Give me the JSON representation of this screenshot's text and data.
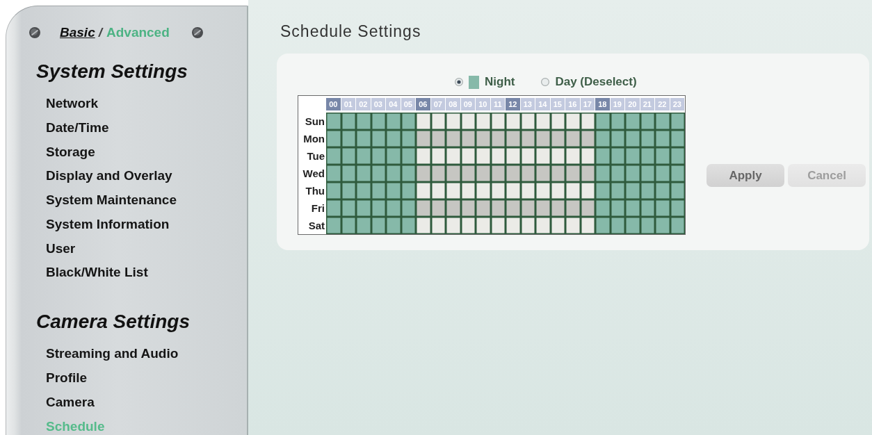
{
  "sidebar": {
    "modes": [
      {
        "label": "Basic",
        "selected": true
      },
      {
        "label": "Advanced",
        "selected": false
      }
    ],
    "mode_separator": "/",
    "sections": [
      {
        "title": "System Settings",
        "items": [
          {
            "label": "Network",
            "selected": false
          },
          {
            "label": "Date/Time",
            "selected": false
          },
          {
            "label": "Storage",
            "selected": false
          },
          {
            "label": "Display and Overlay",
            "selected": false
          },
          {
            "label": "System Maintenance",
            "selected": false
          },
          {
            "label": "System Information",
            "selected": false
          },
          {
            "label": "User",
            "selected": false
          },
          {
            "label": "Black/White List",
            "selected": false
          }
        ]
      },
      {
        "title": "Camera Settings",
        "items": [
          {
            "label": "Streaming and Audio",
            "selected": false
          },
          {
            "label": "Profile",
            "selected": false
          },
          {
            "label": "Camera",
            "selected": false
          },
          {
            "label": "Schedule",
            "selected": true
          }
        ]
      }
    ]
  },
  "main": {
    "title": "Schedule Settings",
    "legend": [
      {
        "kind": "night",
        "label": "Night",
        "selected": true
      },
      {
        "kind": "day",
        "label": "Day (Deselect)",
        "selected": false
      }
    ],
    "schedule": {
      "hours": [
        {
          "label": "00",
          "marked": true
        },
        {
          "label": "01",
          "marked": false
        },
        {
          "label": "02",
          "marked": false
        },
        {
          "label": "03",
          "marked": false
        },
        {
          "label": "04",
          "marked": false
        },
        {
          "label": "05",
          "marked": false
        },
        {
          "label": "06",
          "marked": true
        },
        {
          "label": "07",
          "marked": false
        },
        {
          "label": "08",
          "marked": false
        },
        {
          "label": "09",
          "marked": false
        },
        {
          "label": "10",
          "marked": false
        },
        {
          "label": "11",
          "marked": false
        },
        {
          "label": "12",
          "marked": true
        },
        {
          "label": "13",
          "marked": false
        },
        {
          "label": "14",
          "marked": false
        },
        {
          "label": "15",
          "marked": false
        },
        {
          "label": "16",
          "marked": false
        },
        {
          "label": "17",
          "marked": false
        },
        {
          "label": "18",
          "marked": true
        },
        {
          "label": "19",
          "marked": false
        },
        {
          "label": "20",
          "marked": false
        },
        {
          "label": "21",
          "marked": false
        },
        {
          "label": "22",
          "marked": false
        },
        {
          "label": "23",
          "marked": false
        }
      ],
      "rows": [
        {
          "day": "Sun",
          "night": [
            true,
            true,
            true,
            true,
            true,
            true,
            false,
            false,
            false,
            false,
            false,
            false,
            false,
            false,
            false,
            false,
            false,
            false,
            true,
            true,
            true,
            true,
            true,
            true
          ]
        },
        {
          "day": "Mon",
          "night": [
            true,
            true,
            true,
            true,
            true,
            true,
            false,
            false,
            false,
            false,
            false,
            false,
            false,
            false,
            false,
            false,
            false,
            false,
            true,
            true,
            true,
            true,
            true,
            true
          ]
        },
        {
          "day": "Tue",
          "night": [
            true,
            true,
            true,
            true,
            true,
            true,
            false,
            false,
            false,
            false,
            false,
            false,
            false,
            false,
            false,
            false,
            false,
            false,
            true,
            true,
            true,
            true,
            true,
            true
          ]
        },
        {
          "day": "Wed",
          "night": [
            true,
            true,
            true,
            true,
            true,
            true,
            false,
            false,
            false,
            false,
            false,
            false,
            false,
            false,
            false,
            false,
            false,
            false,
            true,
            true,
            true,
            true,
            true,
            true
          ]
        },
        {
          "day": "Thu",
          "night": [
            true,
            true,
            true,
            true,
            true,
            true,
            false,
            false,
            false,
            false,
            false,
            false,
            false,
            false,
            false,
            false,
            false,
            false,
            true,
            true,
            true,
            true,
            true,
            true
          ]
        },
        {
          "day": "Fri",
          "night": [
            true,
            true,
            true,
            true,
            true,
            true,
            false,
            false,
            false,
            false,
            false,
            false,
            false,
            false,
            false,
            false,
            false,
            false,
            true,
            true,
            true,
            true,
            true,
            true
          ]
        },
        {
          "day": "Sat",
          "night": [
            true,
            true,
            true,
            true,
            true,
            true,
            false,
            false,
            false,
            false,
            false,
            false,
            false,
            false,
            false,
            false,
            false,
            false,
            true,
            true,
            true,
            true,
            true,
            true
          ]
        }
      ]
    },
    "buttons": [
      {
        "label": "Apply",
        "disabled": false
      },
      {
        "label": "Cancel",
        "disabled": true
      }
    ]
  }
}
